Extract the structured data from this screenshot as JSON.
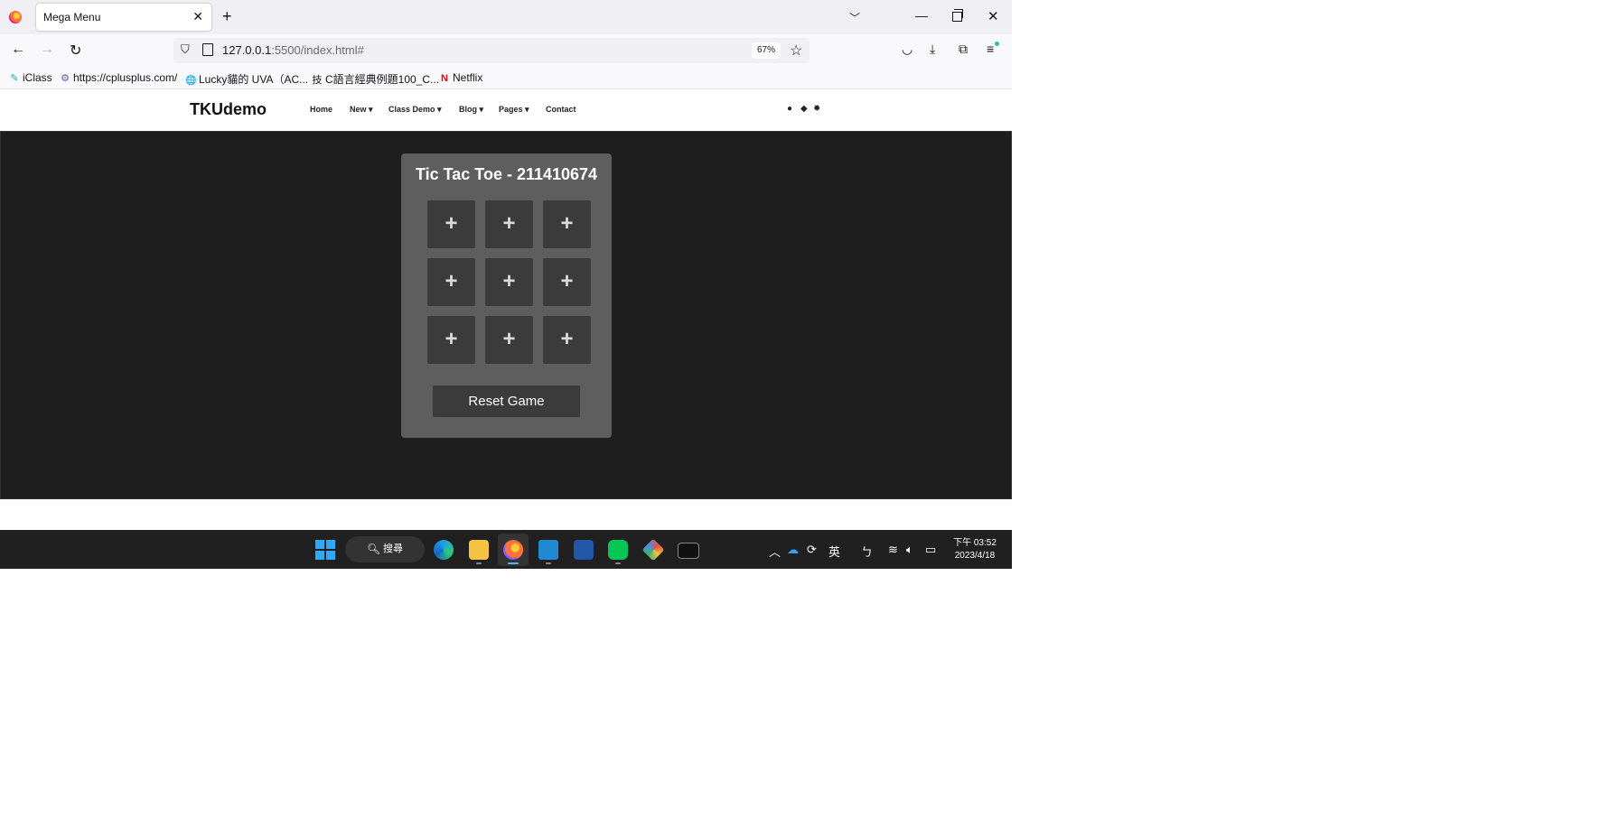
{
  "browser": {
    "tab_title": "Mega Menu",
    "tab_close": "✕",
    "new_tab": "+",
    "url_host": "127.0.0.1",
    "url_rest": ":5500/index.html#",
    "zoom": "67%",
    "bookmarks": [
      {
        "icon": "iclass-icon",
        "glyph": "✎",
        "label": "iClass"
      },
      {
        "icon": "cplusplus-icon",
        "glyph": "⚙",
        "label": "https://cplusplus.com/"
      },
      {
        "icon": "globe-icon",
        "glyph": "🌐",
        "label": "Lucky貓的 UVA（AC..."
      },
      {
        "icon": "book-icon",
        "glyph": "技",
        "label": "C語言經典例題100_C..."
      },
      {
        "icon": "netflix-icon",
        "glyph": "N",
        "label": "Netflix"
      }
    ]
  },
  "site": {
    "brand": "TKUdemo",
    "menu": [
      "Home",
      "New ▾",
      "Class Demo ▾",
      "Blog ▾",
      "Pages ▾",
      "Contact"
    ],
    "header_icons": [
      "github-icon",
      "diamond-icon",
      "gear-icon"
    ]
  },
  "game": {
    "title": "Tic Tac Toe - 211410674",
    "cells": [
      "+",
      "+",
      "+",
      "+",
      "+",
      "+",
      "+",
      "+",
      "+"
    ],
    "reset_label": "Reset Game"
  },
  "taskbar": {
    "search_label": "搜尋",
    "ime_label": "英",
    "ime_mode": "ㄅ",
    "time": "下午 03:52",
    "date": "2023/4/18"
  },
  "colors": {
    "game_background": "#1e1e1e",
    "panel": "#5e5e5e",
    "cell": "#3b3b3b"
  }
}
